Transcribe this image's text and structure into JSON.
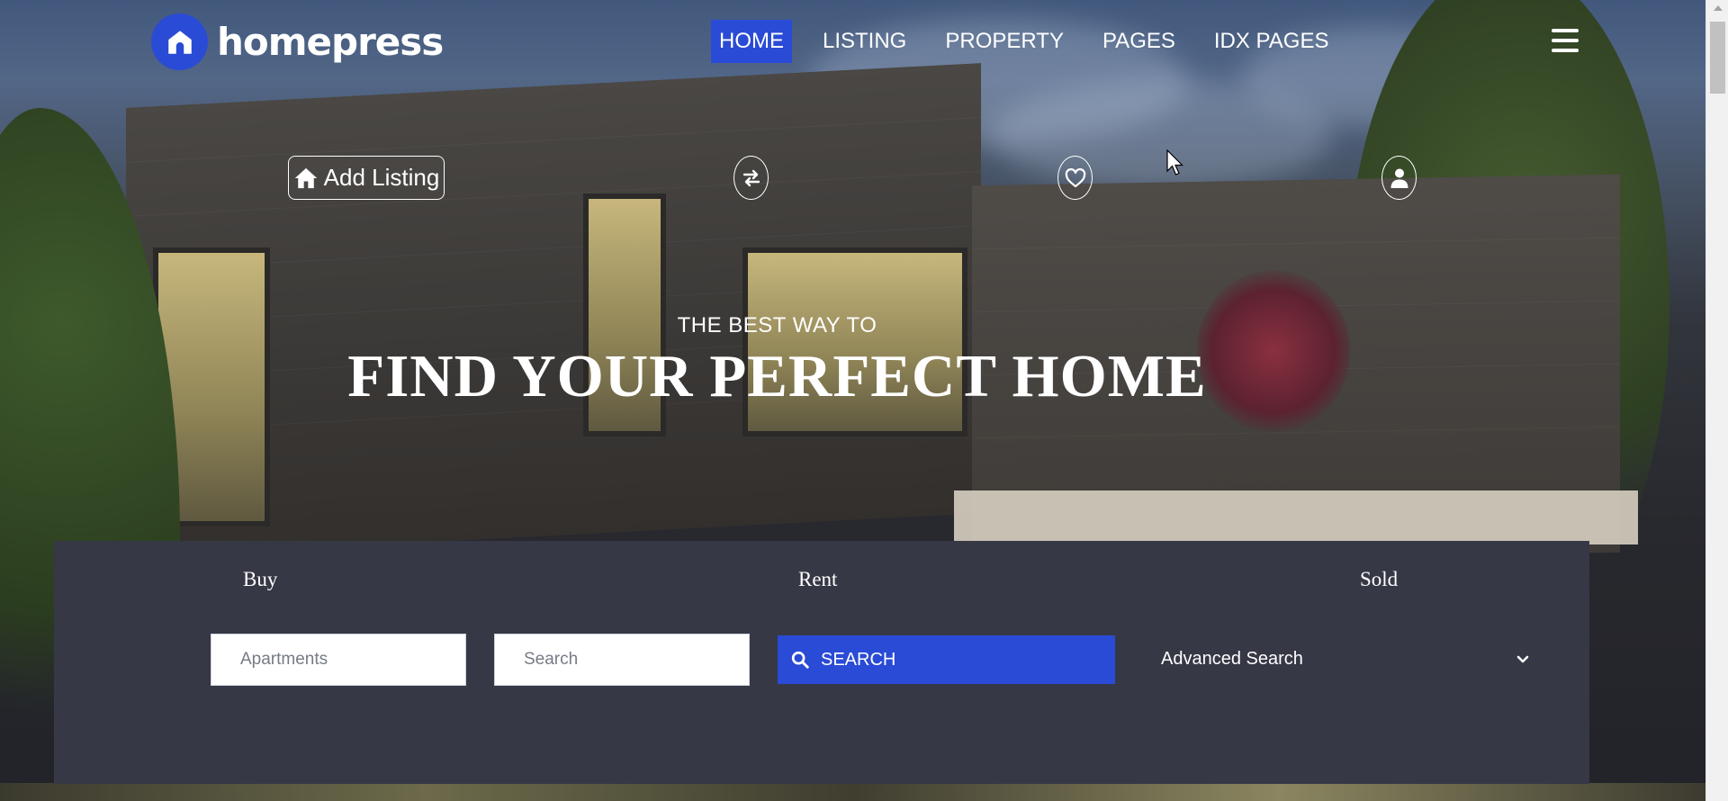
{
  "brand": {
    "name": "homepress"
  },
  "nav": {
    "items": [
      {
        "label": "HOME",
        "active": true
      },
      {
        "label": "LISTING",
        "active": false
      },
      {
        "label": "PROPERTY",
        "active": false
      },
      {
        "label": "PAGES",
        "active": false
      },
      {
        "label": "IDX PAGES",
        "active": false
      }
    ],
    "menu_icon": "hamburger-icon"
  },
  "actions": {
    "add_listing_label": "Add Listing",
    "icons": [
      "home-icon",
      "compare-icon",
      "heart-icon",
      "user-icon"
    ]
  },
  "hero": {
    "tagline": "THE BEST WAY TO",
    "headline": "FIND YOUR PERFECT HOME"
  },
  "search": {
    "tabs": [
      "Buy",
      "Rent",
      "Sold"
    ],
    "type_placeholder": "Apartments",
    "keyword_placeholder": "Search",
    "search_button_label": "SEARCH",
    "advanced_label": "Advanced Search"
  },
  "colors": {
    "accent": "#2a4bd6",
    "panel": "#363846",
    "text_light": "#ffffff"
  }
}
